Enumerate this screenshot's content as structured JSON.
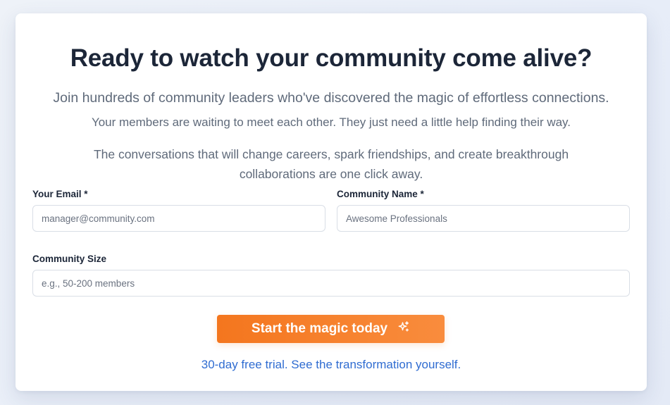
{
  "hero": {
    "title": "Ready to watch your community come alive?",
    "lead": "Join hundreds of community leaders who've discovered the magic of effortless connections.",
    "sub": "Your members are waiting to meet each other. They just need a little help finding their way.",
    "paragraph": "The conversations that will change careers, spark friendships, and create breakthrough collaborations are one click away."
  },
  "form": {
    "email": {
      "label": "Your Email *",
      "placeholder": "manager@community.com"
    },
    "community_name": {
      "label": "Community Name *",
      "placeholder": "Awesome Professionals"
    },
    "community_size": {
      "label": "Community Size",
      "placeholder": "e.g., 50-200 members"
    },
    "submit_label": "Start the magic today",
    "submit_icon": "sparkles-icon"
  },
  "trial_link": "30-day free trial. See the transformation yourself.",
  "colors": {
    "accent": "#f4761e",
    "link": "#2f6cd1",
    "heading": "#1c2638",
    "muted": "#5f6a7a"
  }
}
